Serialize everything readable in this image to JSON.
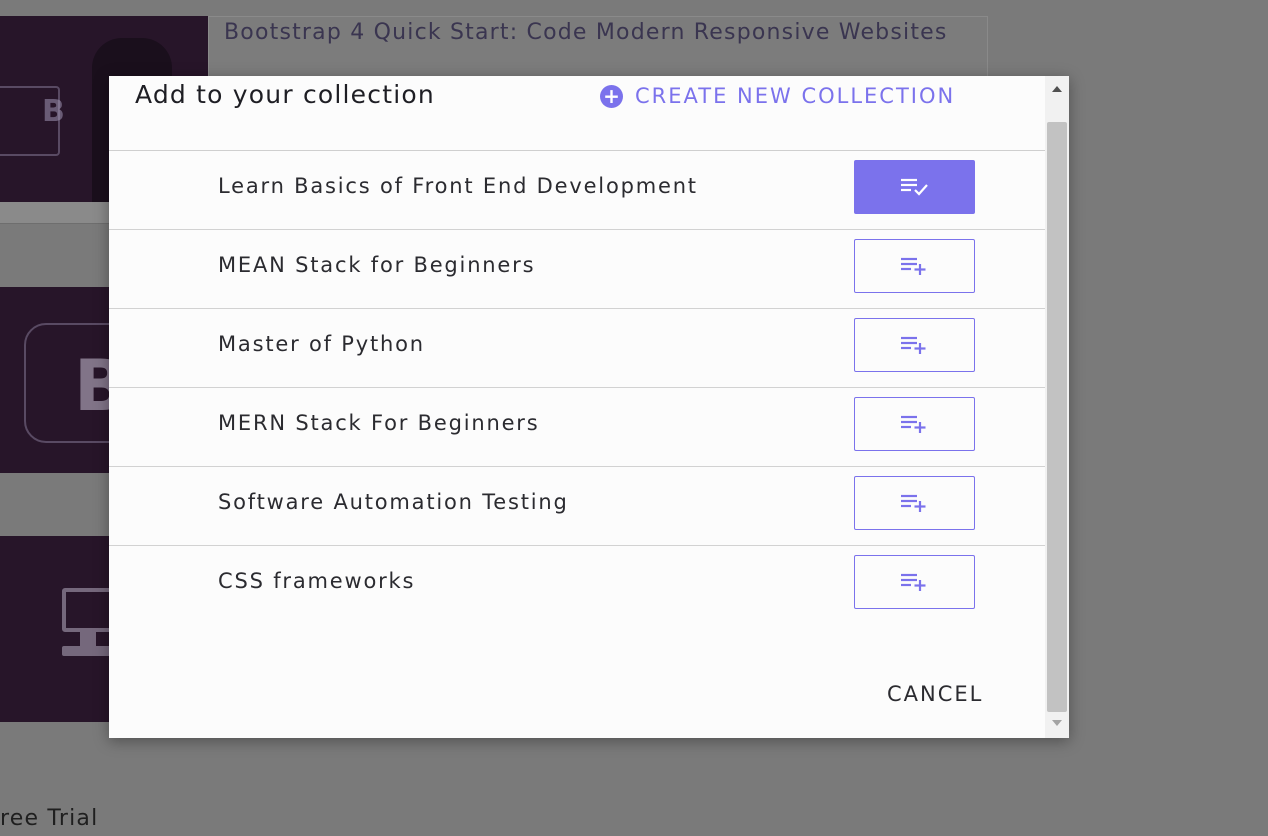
{
  "background": {
    "course_title": "Bootstrap 4 Quick Start: Code Modern Responsive Websites",
    "footer_text": "ree Trial"
  },
  "modal": {
    "title": "Add to your collection",
    "create_label": "CREATE NEW COLLECTION",
    "cancel_label": "CANCEL",
    "accent_color": "#7b72ec",
    "collections": [
      {
        "name": "Learn Basics of Front End Development",
        "added": true,
        "icon": "playlist-check-icon"
      },
      {
        "name": "MEAN Stack for Beginners",
        "added": false,
        "icon": "playlist-add-icon"
      },
      {
        "name": "Master of Python",
        "added": false,
        "icon": "playlist-add-icon"
      },
      {
        "name": "MERN Stack For Beginners",
        "added": false,
        "icon": "playlist-add-icon"
      },
      {
        "name": "Software Automation Testing",
        "added": false,
        "icon": "playlist-add-icon"
      },
      {
        "name": "CSS frameworks",
        "added": false,
        "icon": "playlist-add-icon"
      }
    ]
  }
}
